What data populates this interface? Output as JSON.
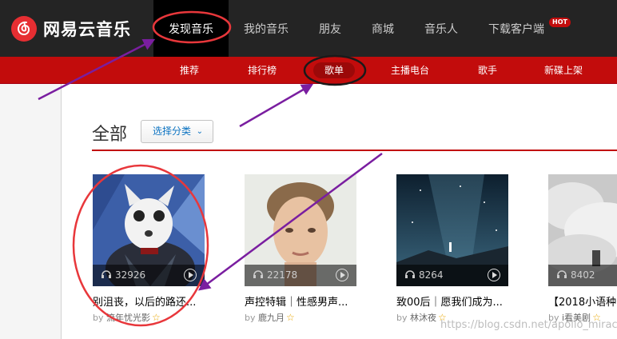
{
  "header": {
    "logo_text": "网易云音乐",
    "nav": [
      {
        "label": "发现音乐",
        "active": true
      },
      {
        "label": "我的音乐"
      },
      {
        "label": "朋友"
      },
      {
        "label": "商城"
      },
      {
        "label": "音乐人"
      },
      {
        "label": "下载客户端",
        "badge": "HOT"
      }
    ]
  },
  "subnav": [
    "推荐",
    "排行榜",
    "歌单",
    "主播电台",
    "歌手",
    "新碟上架"
  ],
  "subnav_active": "歌单",
  "section": {
    "title": "全部",
    "category_button": "选择分类",
    "chevron_icon": "chevron-down-icon"
  },
  "playlists": [
    {
      "play_count": "32926",
      "title": "别沮丧，以后的路还...",
      "by": "by",
      "creator": "流年忧光影",
      "badge_icon": "star-icon"
    },
    {
      "play_count": "22178",
      "title": "声控特辑｜性感男声...",
      "by": "by",
      "creator": "鹿九月",
      "badge_icon": "star-icon"
    },
    {
      "play_count": "8264",
      "title": "致00后｜愿我们成为...",
      "by": "by",
      "creator": "林沐夜",
      "badge_icon": "star-icon"
    },
    {
      "play_count": "8402",
      "title": "【2018小语种",
      "by": "by",
      "creator": "i看美剧",
      "badge_icon": "star-icon"
    }
  ],
  "watermark": "https://blog.csdn.net/apollo_miracle",
  "colors": {
    "brand_red": "#c20c0c",
    "topbar": "#242424",
    "annotation_red": "#e8373b",
    "annotation_purple": "#7a1ea0"
  }
}
